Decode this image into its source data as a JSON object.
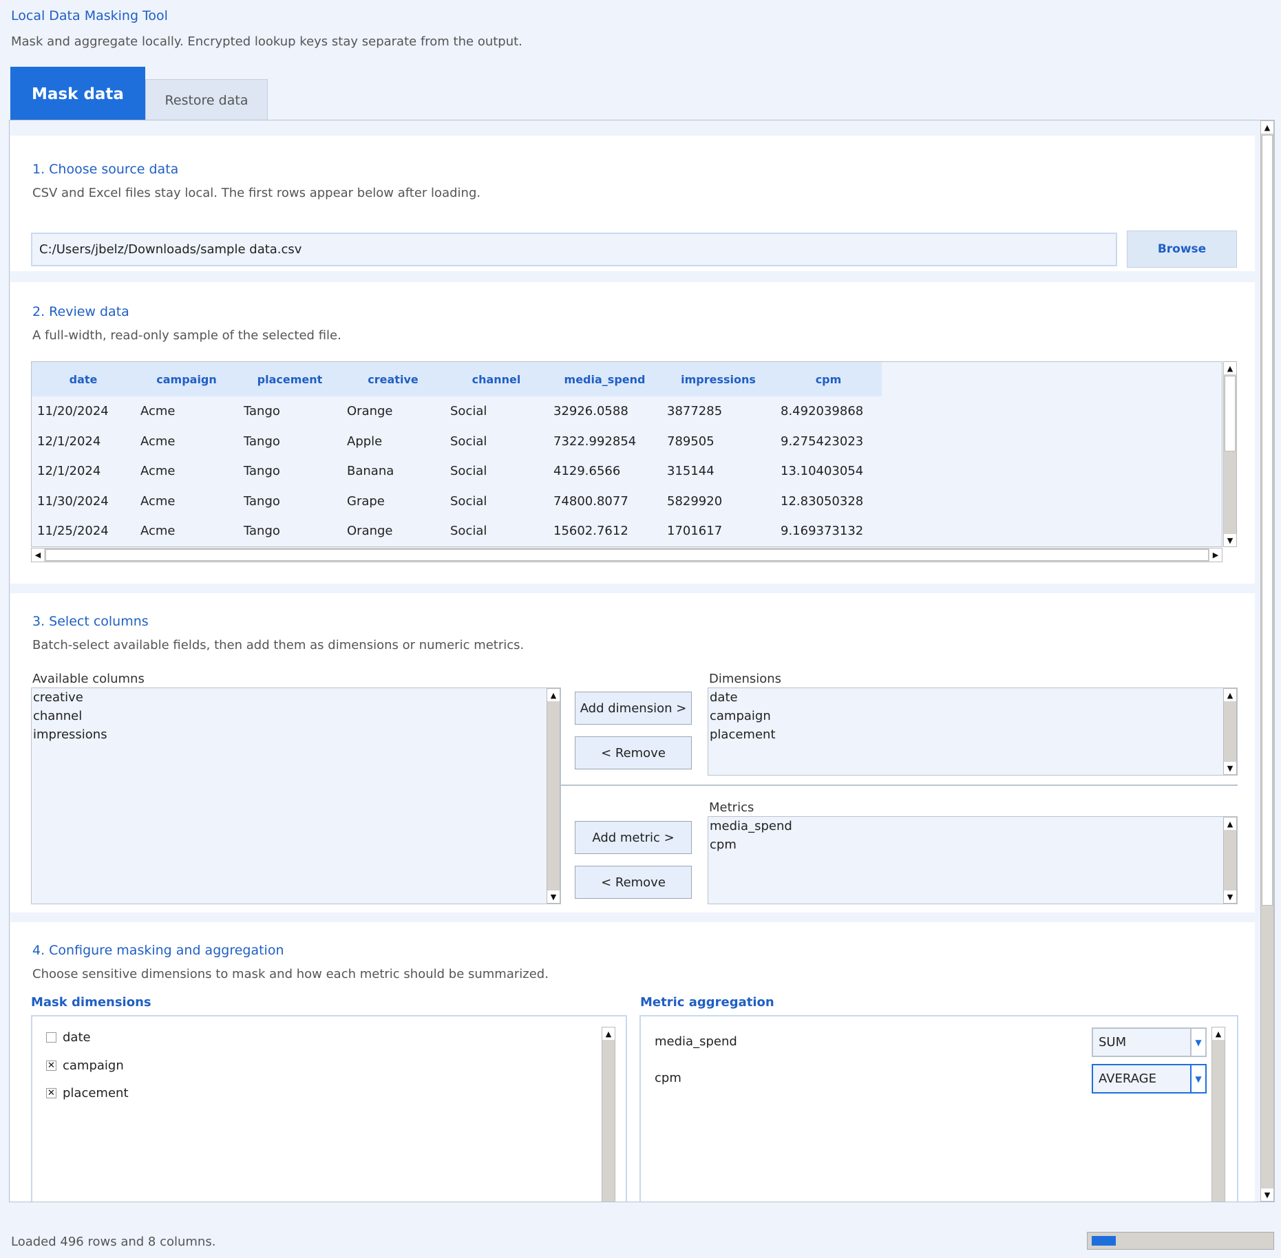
{
  "app": {
    "title": "Local Data Masking Tool",
    "subtitle": "Mask and aggregate locally. Encrypted lookup keys stay separate from the output."
  },
  "tabs": [
    {
      "label": "Mask data",
      "active": true
    },
    {
      "label": "Restore data",
      "active": false
    }
  ],
  "step1": {
    "title": "1. Choose source data",
    "description": "CSV and Excel files stay local. The first rows appear below after loading.",
    "file_path": "C:/Users/jbelz/Downloads/sample data.csv",
    "browse_label": "Browse"
  },
  "step2": {
    "title": "2. Review data",
    "description": "A full-width, read-only sample of the selected file.",
    "columns": [
      "date",
      "campaign",
      "placement",
      "creative",
      "channel",
      "media_spend",
      "impressions",
      "cpm"
    ],
    "rows": [
      [
        "11/20/2024",
        "Acme",
        "Tango",
        "Orange",
        "Social",
        "32926.0588",
        "3877285",
        "8.492039868"
      ],
      [
        "12/1/2024",
        "Acme",
        "Tango",
        "Apple",
        "Social",
        "7322.992854",
        "789505",
        "9.275423023"
      ],
      [
        "12/1/2024",
        "Acme",
        "Tango",
        "Banana",
        "Social",
        "4129.6566",
        "315144",
        "13.10403054"
      ],
      [
        "11/30/2024",
        "Acme",
        "Tango",
        "Grape",
        "Social",
        "74800.8077",
        "5829920",
        "12.83050328"
      ],
      [
        "11/25/2024",
        "Acme",
        "Tango",
        "Orange",
        "Social",
        "15602.7612",
        "1701617",
        "9.169373132"
      ]
    ]
  },
  "step3": {
    "title": "3. Select columns",
    "description": "Batch-select available fields, then add them as dimensions or numeric metrics.",
    "available_label": "Available columns",
    "available": [
      "creative",
      "channel",
      "impressions"
    ],
    "add_dimension_label": "Add dimension >",
    "remove_label": "< Remove",
    "dimensions_label": "Dimensions",
    "dimensions": [
      "date",
      "campaign",
      "placement"
    ],
    "add_metric_label": "Add metric >",
    "metrics_label": "Metrics",
    "metrics": [
      "media_spend",
      "cpm"
    ]
  },
  "step4": {
    "title": "4. Configure masking and aggregation",
    "description": "Choose sensitive dimensions to mask and how each metric should be summarized.",
    "mask_header": "Mask dimensions",
    "mask_items": [
      {
        "label": "date",
        "checked": false
      },
      {
        "label": "campaign",
        "checked": true
      },
      {
        "label": "placement",
        "checked": true
      }
    ],
    "aggregation_header": "Metric aggregation",
    "aggregations": [
      {
        "metric": "media_spend",
        "function": "SUM"
      },
      {
        "metric": "cpm",
        "function": "AVERAGE"
      }
    ]
  },
  "status": {
    "message": "Loaded 496 rows and 8 columns.",
    "progress": 0.13
  },
  "colors": {
    "accent": "#1e6fdb",
    "heading": "#1f5fc4",
    "background": "#eef3fc"
  }
}
